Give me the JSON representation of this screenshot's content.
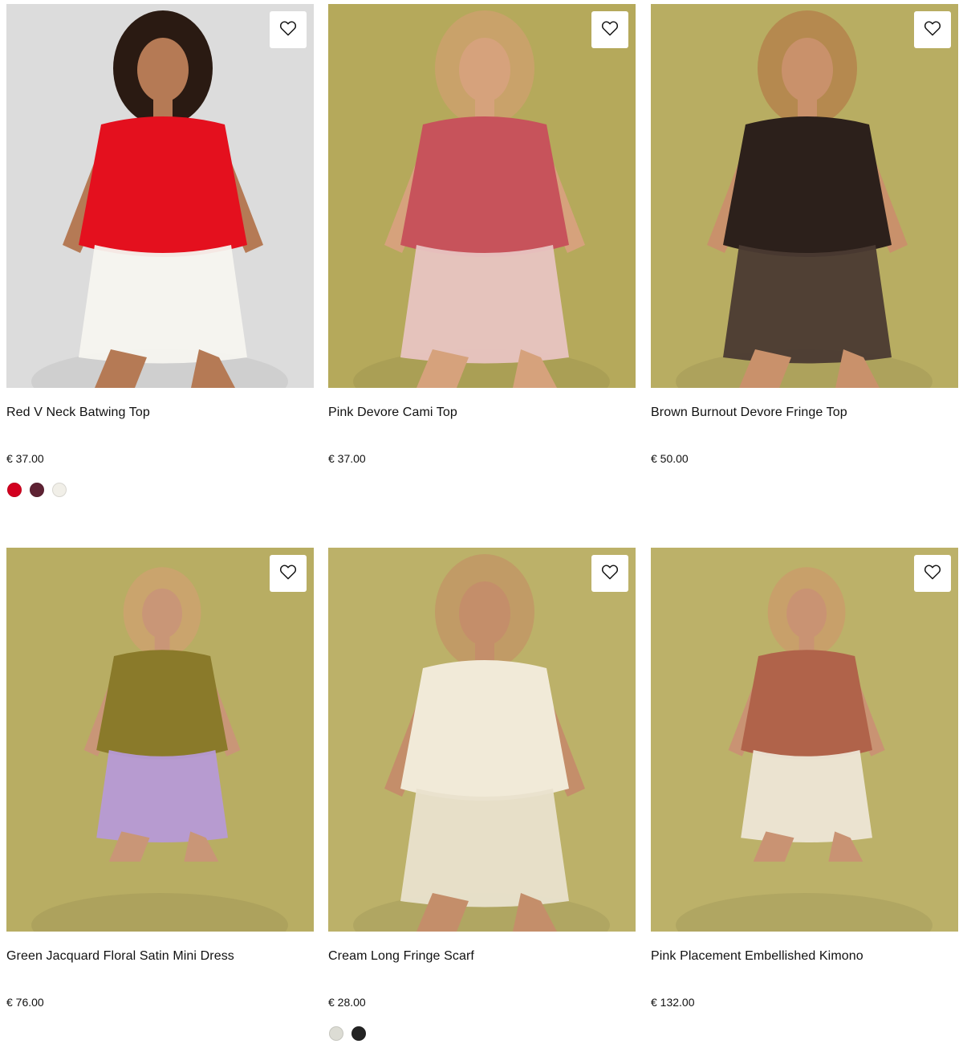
{
  "products": [
    {
      "name": "Red V Neck Batwing Top",
      "price": "€ 37.00",
      "wishlist_icon": "heart-outline-icon",
      "swatches": [
        "#d3001f",
        "#5e2233",
        "#f1efe8"
      ],
      "photo": {
        "bg": "#dcdcdc",
        "garment": "#e4101e",
        "skin": "#b57a55",
        "hair": "#2a1a12",
        "accent": "#f6f4ef"
      }
    },
    {
      "name": "Pink Devore Cami Top",
      "price": "€ 37.00",
      "wishlist_icon": "heart-outline-icon",
      "swatches": [],
      "photo": {
        "bg": "#b5a95b",
        "garment": "#c7535b",
        "skin": "#d6a27c",
        "hair": "#c9a26a",
        "accent": "#e8c4c2"
      }
    },
    {
      "name": "Brown Burnout Devore Fringe Top",
      "price": "€ 50.00",
      "wishlist_icon": "heart-outline-icon",
      "swatches": [],
      "photo": {
        "bg": "#b8ad62",
        "garment": "#2c201b",
        "skin": "#c9916b",
        "hair": "#b5894f",
        "accent": "#4a3a32"
      }
    },
    {
      "name": "Green Jacquard Floral Satin Mini Dress",
      "price": "€ 76.00",
      "wishlist_icon": "heart-outline-icon",
      "swatches": [],
      "photo": {
        "bg": "#b8ad63",
        "garment": "#8a7a2a",
        "skin": "#c99677",
        "hair": "#caa46d",
        "accent": "#b69ad6"
      }
    },
    {
      "name": "Cream Long Fringe Scarf",
      "price": "€ 28.00",
      "wishlist_icon": "heart-outline-icon",
      "swatches": [
        "#dcdcd4",
        "#232323"
      ],
      "photo": {
        "bg": "#bcb169",
        "garment": "#f1ead8",
        "skin": "#c48e6a",
        "hair": "#c19b66",
        "accent": "#e9e1cd"
      }
    },
    {
      "name": "Pink Placement Embellished Kimono",
      "price": "€ 132.00",
      "wishlist_icon": "heart-outline-icon",
      "swatches": [],
      "photo": {
        "bg": "#bcb169",
        "garment": "#b0634a",
        "skin": "#c99373",
        "hair": "#c8a06a",
        "accent": "#ede6d6"
      }
    }
  ]
}
